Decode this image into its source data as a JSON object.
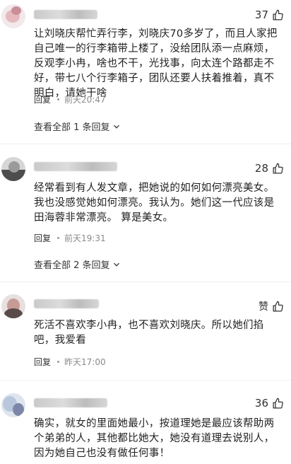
{
  "comments": [
    {
      "likes": "37",
      "text": "让刘晓庆帮忙弄行李，刘晓庆70多岁了，而且人家把自己唯一的行李箱带上楼了，没给团队添一点麻烦，反观李小冉，啥也不干，光找事，向太连个路都走不好，带七八个行李箱子，团队还要人扶着推着，真不明白，请她干啥",
      "reply_label": "回复",
      "time": "前天20:47",
      "view_replies": "查看全部 1 条回复"
    },
    {
      "likes": "28",
      "text": "经常看到有人发文章，把她说的如何如何漂亮美女。我也没感觉她如何漂亮。我认为。她们这一代应该是田海蓉非常漂亮。 算是美女。",
      "reply_label": "回复",
      "time": "前天19:31",
      "view_replies": "查看全部 2 条回复"
    },
    {
      "likes": "赞",
      "text": "死活不喜欢李小冉，也不喜欢刘晓庆。所以她们掐吧，我爱看",
      "reply_label": "回复",
      "time": "昨天17:00"
    },
    {
      "likes": "36",
      "text": "确实，就女的里面她最小，按道理她是最应该帮助两个弟弟的人，其他都比她大，她没有道理去说别人，因为她自己也没有做任何事！"
    }
  ],
  "icons": {
    "like": "thumbs-up-icon",
    "expand": "chevron-down-icon"
  }
}
